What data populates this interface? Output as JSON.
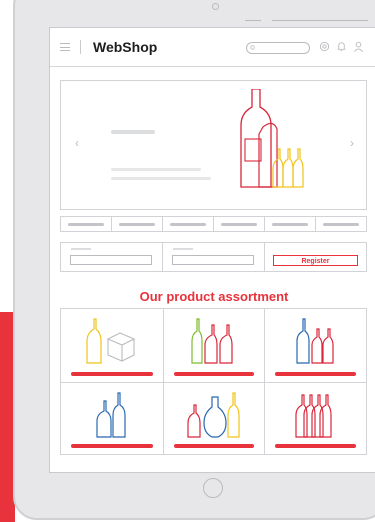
{
  "app": {
    "brand": "WebShop"
  },
  "header": {
    "icons": [
      "menu-icon",
      "search-icon",
      "settings-icon",
      "notification-icon",
      "user-icon"
    ]
  },
  "hero": {
    "carousel_prev_icon": "chevron-left-icon",
    "carousel_next_icon": "chevron-right-icon"
  },
  "form": {
    "register_label": "Register"
  },
  "assortment": {
    "title": "Our product assortment",
    "categories": [
      {
        "icon": "bottle-and-box-icon"
      },
      {
        "icon": "wine-bottles-icon"
      },
      {
        "icon": "blue-red-bottles-icon"
      },
      {
        "icon": "blue-bottles-icon"
      },
      {
        "icon": "decanter-bottles-icon"
      },
      {
        "icon": "red-bottles-icon"
      }
    ]
  },
  "colors": {
    "accent": "#e8333d",
    "bottle_red": "#d9263a",
    "bottle_yellow": "#f0c419",
    "bottle_green": "#7dbb2a",
    "bottle_blue": "#2867b2"
  }
}
